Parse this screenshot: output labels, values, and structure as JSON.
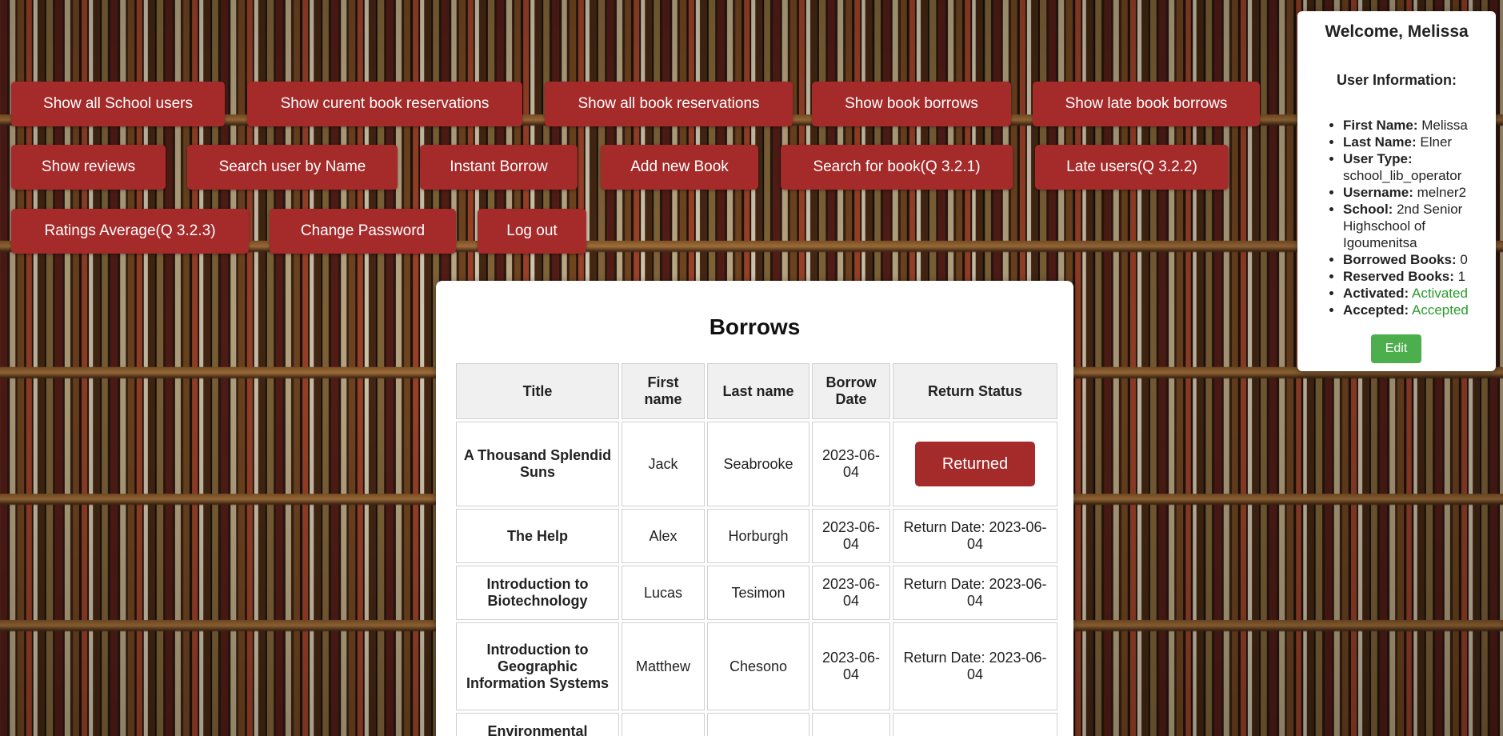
{
  "nav": {
    "row1": [
      "Show all School users",
      "Show curent book reservations",
      "Show all book reservations",
      "Show book borrows",
      "Show late book borrows"
    ],
    "row2": [
      "Show reviews",
      "Search user by Name",
      "Instant Borrow",
      "Add new Book",
      "Search for book(Q 3.2.1)",
      "Late users(Q 3.2.2)"
    ],
    "row3": [
      "Ratings Average(Q 3.2.3)",
      "Change Password",
      "Log out"
    ]
  },
  "borrows": {
    "title": "Borrows",
    "headers": [
      "Title",
      "First name",
      "Last name",
      "Borrow Date",
      "Return Status"
    ],
    "rows": [
      {
        "title": "A Thousand Splendid Suns",
        "first": "Jack",
        "last": "Seabrooke",
        "date": "2023-06-04",
        "status": "Returned"
      },
      {
        "title": "The Help",
        "first": "Alex",
        "last": "Horburgh",
        "date": "2023-06-04",
        "status": "Return Date: 2023-06-04"
      },
      {
        "title": "Introduction to Biotechnology",
        "first": "Lucas",
        "last": "Tesimon",
        "date": "2023-06-04",
        "status": "Return Date: 2023-06-04"
      },
      {
        "title": "Introduction to Geographic Information Systems",
        "first": "Matthew",
        "last": "Chesono",
        "date": "2023-06-04",
        "status": "Return Date: 2023-06-04"
      },
      {
        "title": "Environmental",
        "first": "",
        "last": "",
        "date": "",
        "status": ""
      }
    ]
  },
  "user": {
    "welcome": "Welcome, Melissa",
    "section_title": "User Information:",
    "fields": [
      {
        "label": "First Name:",
        "value": "Melissa"
      },
      {
        "label": "Last Name:",
        "value": "Elner"
      },
      {
        "label": "User Type:",
        "value": "school_lib_operator"
      },
      {
        "label": "Username:",
        "value": "melner2"
      },
      {
        "label": "School:",
        "value": "2nd Senior Highschool of Igoumenitsa"
      },
      {
        "label": "Borrowed Books:",
        "value": "0"
      },
      {
        "label": "Reserved Books:",
        "value": "1"
      },
      {
        "label": "Activated:",
        "value": "Activated"
      },
      {
        "label": "Accepted:",
        "value": "Accepted"
      }
    ],
    "edit_label": "Edit"
  },
  "colors": {
    "button_red": "#a52a2a",
    "status_green": "#2a9a2a",
    "edit_green": "#4cae4c"
  }
}
